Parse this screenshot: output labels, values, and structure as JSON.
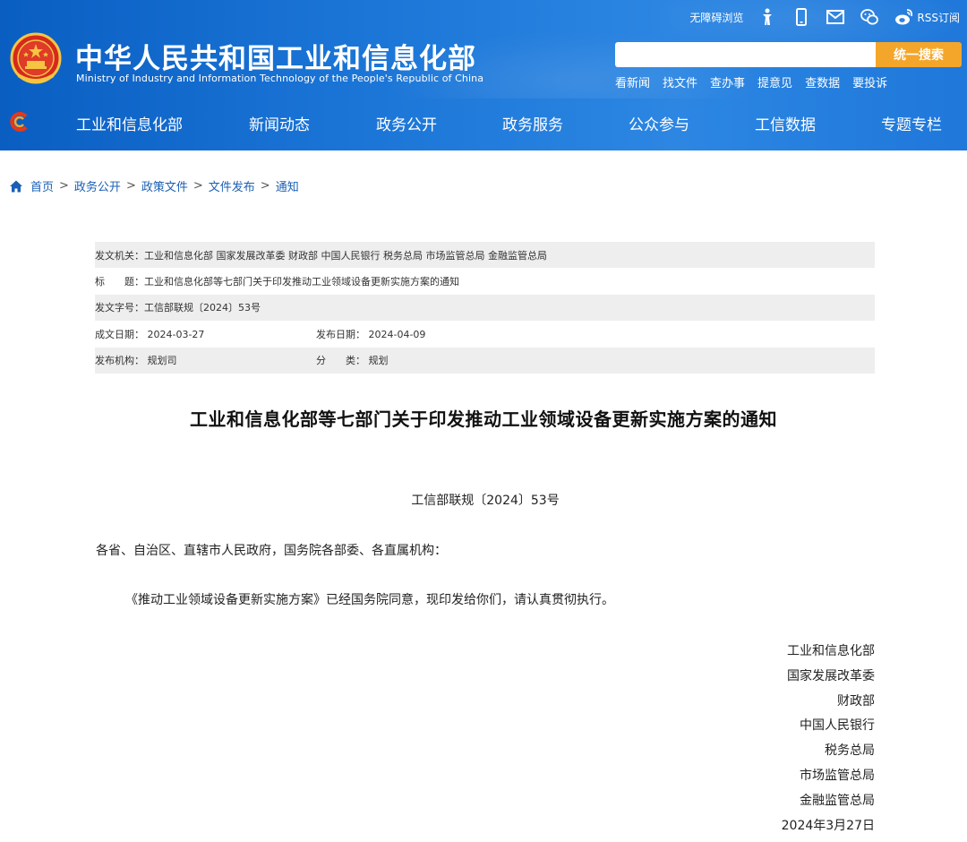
{
  "header": {
    "title": "中华人民共和国工业和信息化部",
    "subtitle": "Ministry of Industry and Information Technology of the People's Republic of China",
    "accessibility_label": "无障碍浏览",
    "rss_label": "RSS订阅",
    "tool_icons": [
      "accessibility-figure-icon",
      "mobile-icon",
      "mail-icon",
      "wechat-icon",
      "weibo-icon"
    ],
    "search": {
      "placeholder": "",
      "button_label": "统一搜索"
    },
    "quick_links": [
      "看新闻",
      "找文件",
      "查办事",
      "提意见",
      "查数据",
      "要投诉"
    ],
    "nav": [
      "工业和信息化部",
      "新闻动态",
      "政务公开",
      "政务服务",
      "公众参与",
      "工信数据",
      "专题专栏"
    ]
  },
  "breadcrumb": [
    "首页",
    "政务公开",
    "政策文件",
    "文件发布",
    "通知"
  ],
  "info": {
    "issuer_label": "发文机关：",
    "issuer": "工业和信息化部 国家发展改革委 财政部 中国人民银行 税务总局 市场监管总局 金融监管总局",
    "title_label": "标　　题：",
    "title": "工业和信息化部等七部门关于印发推动工业领域设备更新实施方案的通知",
    "doc_no_label": "发文字号：",
    "doc_no": "工信部联规〔2024〕53号",
    "created_label": "成文日期：",
    "created": "2024-03-27",
    "published_label": "发布日期：",
    "published": "2024-04-09",
    "org_label": "发布机构：",
    "org": "规划司",
    "category_label": "分　　类：",
    "category": "规划"
  },
  "document": {
    "title": "工业和信息化部等七部门关于印发推动工业领域设备更新实施方案的通知",
    "doc_no": "工信部联规〔2024〕53号",
    "addressee": "各省、自治区、直辖市人民政府，国务院各部委、各直属机构：",
    "body": "《推动工业领域设备更新实施方案》已经国务院同意，现印发给你们，请认真贯彻执行。",
    "signatories": [
      "工业和信息化部",
      "国家发展改革委",
      "财政部",
      "中国人民银行",
      "税务总局",
      "市场监管总局",
      "金融监管总局"
    ],
    "date": "2024年3月27日"
  },
  "colors": {
    "header_blue": "#1a74d6",
    "search_button": "#f4a62a",
    "link_blue": "#1a5fb4",
    "table_shade": "#eeeeee"
  }
}
